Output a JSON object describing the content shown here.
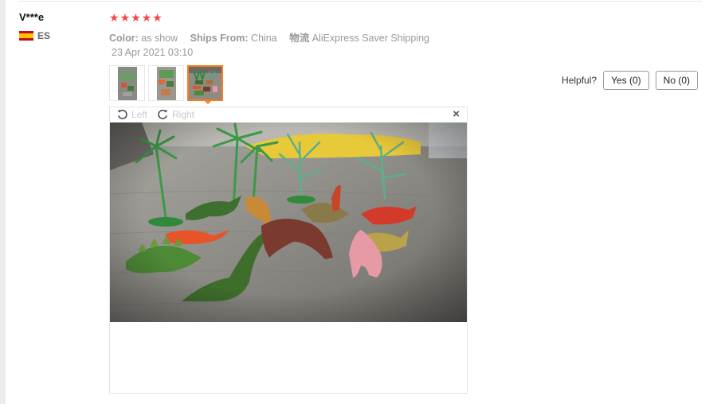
{
  "review": {
    "username": "V***e",
    "country_code": "ES",
    "rating_stars": 5,
    "meta": {
      "color_label": "Color:",
      "color_value": "as show",
      "ships_label": "Ships From:",
      "ships_value": "China",
      "logistics_label": "物流",
      "logistics_value": "AliExpress Saver Shipping"
    },
    "date": "23 Apr 2021 03:10",
    "thumbnails_count": 3,
    "active_thumbnail": 3
  },
  "helpful": {
    "label": "Helpful?",
    "yes_label": "Yes (0)",
    "no_label": "No (0)"
  },
  "viewer": {
    "rotate_left_label": "Left",
    "rotate_right_label": "Right",
    "close_glyph": "×"
  },
  "colors": {
    "star": "#f04a4a",
    "active_border": "#ff7a1a"
  },
  "icons": [
    "flag-es-icon",
    "star-icon",
    "rotate-left-icon",
    "rotate-right-icon",
    "close-icon"
  ]
}
